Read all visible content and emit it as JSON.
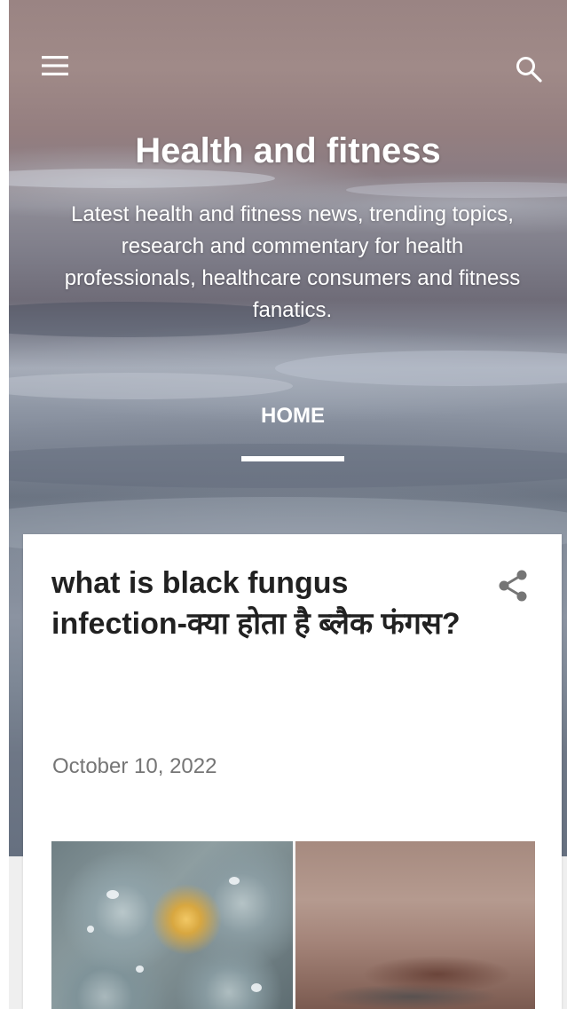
{
  "header": {
    "title": "Health and fitness",
    "description": "Latest health and fitness news, trending topics, research and commentary for health professionals, healthcare consumers and fitness fanatics.",
    "menu_icon": "hamburger-menu-icon",
    "search_icon": "search-icon"
  },
  "nav": {
    "items": [
      {
        "label": "HOME",
        "active": true
      }
    ]
  },
  "post": {
    "title": "what is black fungus infection-क्या होता है ब्लैक फंगस?",
    "date": "October 10, 2022",
    "share_icon": "share-icon"
  },
  "colors": {
    "title_text": "#212121",
    "date_text": "#757575",
    "header_text": "#ffffff",
    "page_band": "#efefef"
  }
}
